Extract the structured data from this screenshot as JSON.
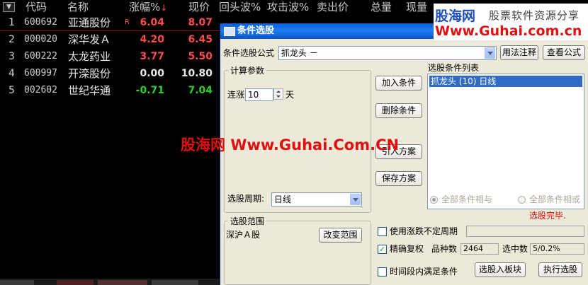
{
  "table": {
    "menu_icon": "dropdown-triangle-icon",
    "headers": [
      "代码",
      "名称",
      "涨幅%",
      "现价",
      "回头波%",
      "攻击波%",
      "卖出价",
      "总量",
      "现量"
    ],
    "sort_indicator": "↓",
    "rows": [
      {
        "index": "1",
        "code": "600692",
        "name": "亚通股份",
        "flag": "R",
        "change": "6.04",
        "price": "8.07",
        "dir": "up"
      },
      {
        "index": "2",
        "code": "000020",
        "name": "深华发Ａ",
        "flag": "",
        "change": "4.20",
        "price": "6.45",
        "dir": "up"
      },
      {
        "index": "3",
        "code": "600222",
        "name": "太龙药业",
        "flag": "",
        "change": "3.77",
        "price": "5.50",
        "dir": "up"
      },
      {
        "index": "4",
        "code": "600997",
        "name": "开滦股份",
        "flag": "",
        "change": "0.00",
        "price": "10.80",
        "dir": "flat"
      },
      {
        "index": "5",
        "code": "002602",
        "name": "世纪华通",
        "flag": "",
        "change": "-0.71",
        "price": "7.04",
        "dir": "down"
      }
    ]
  },
  "watermark": {
    "logo_name": "股海网",
    "logo_slogan": "股票软件资源分享",
    "logo_url": "Www.Guhai.com.cn",
    "center": "股海网 Www.Guhai.Com.CN"
  },
  "dialog": {
    "title": "条件选股",
    "formula_label": "条件选股公式",
    "formula_value": "抓龙头    －",
    "usage_button": "用法注释",
    "view_formula_button": "查看公式",
    "params_group": "计算参数",
    "param_label": "连涨",
    "param_value": "10",
    "param_unit": "天",
    "period_label": "选股周期:",
    "period_value": "日线",
    "add_condition": "加入条件",
    "delete_condition": "删除条件",
    "import_plan": "引入方案",
    "save_plan": "保存方案",
    "list_title": "选股条件列表",
    "list_items": [
      "抓龙头 (10) 日线"
    ],
    "radio_and": "全部条件相与",
    "radio_or": "全部条件相或",
    "status": "选股完毕.",
    "range_group": "选股范围",
    "range_value": "深沪Ａ股",
    "change_range": "改变范围",
    "use_period_label": "使用涨跌不定周期",
    "use_period_checked": false,
    "exact_fq_label": "精确复权",
    "exact_fq_checked": true,
    "varieties_label": "品种数",
    "varieties_value": "2464",
    "selected_label": "选中数",
    "selected_value": "5/0.2%",
    "time_range_label": "时间段内满足条件",
    "time_range_checked": false,
    "to_block_button": "选股入板块",
    "execute_button": "执行选股"
  },
  "colors": {
    "up": "#ff4b4b",
    "down": "#2ad12a",
    "flat": "#e8e8e8",
    "titlebar": "#0a5fd8",
    "dialog_bg": "#ece9d8",
    "watermark_red": "#e01010",
    "watermark_blue": "#1d4fb8"
  }
}
